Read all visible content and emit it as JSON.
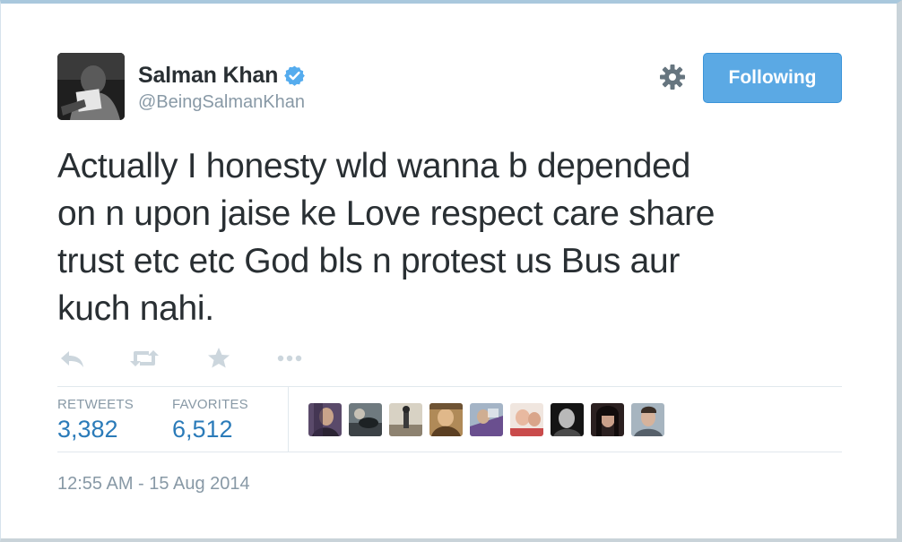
{
  "user": {
    "name": "Salman Khan",
    "handle": "@BeingSalmanKhan",
    "verified_color": "#55acee"
  },
  "follow_button": {
    "label": "Following",
    "color": "#5ba9e4"
  },
  "tweet": {
    "text": "Actually I honesty wld  wanna b depended\non n upon jaise ke  Love respect care share\ntrust etc etc God bls n protest us  Bus aur\nkuch nahi."
  },
  "actions": {
    "icons": [
      "reply-icon",
      "retweet-icon",
      "favorite-icon",
      "more-icon"
    ]
  },
  "stats": {
    "retweets_label": "RETWEETS",
    "retweets_value": "3,382",
    "favorites_label": "FAVORITES",
    "favorites_value": "6,512"
  },
  "favoriters": {
    "count_shown": 9
  },
  "timestamp": "12:55 AM - 15 Aug 2014",
  "colors": {
    "text": "#292f33",
    "muted": "#8899a6",
    "link": "#2b7bb9",
    "action_icon": "#ccd6dd"
  }
}
